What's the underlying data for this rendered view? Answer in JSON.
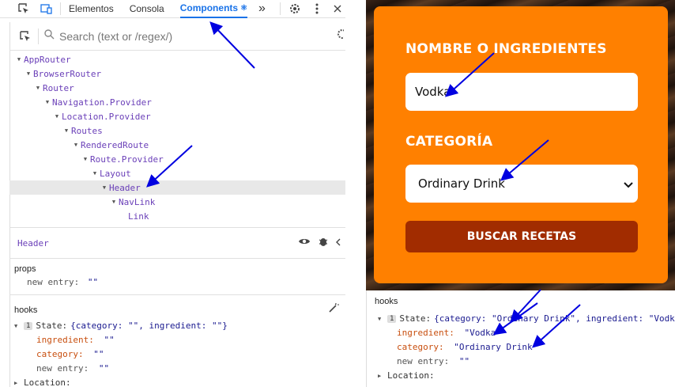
{
  "devtools": {
    "tabs": [
      {
        "label": "Elementos"
      },
      {
        "label": "Consola"
      },
      {
        "label": "Components"
      }
    ],
    "more_label": "»",
    "search_placeholder": "Search (text or /regex/)",
    "tree": [
      {
        "name": "AppRouter"
      },
      {
        "name": "BrowserRouter"
      },
      {
        "name": "Router"
      },
      {
        "name": "Navigation.Provider"
      },
      {
        "name": "Location.Provider"
      },
      {
        "name": "Routes"
      },
      {
        "name": "RenderedRoute"
      },
      {
        "name": "Route.Provider"
      },
      {
        "name": "Layout"
      },
      {
        "name": "Header"
      },
      {
        "name": "NavLink"
      },
      {
        "name": "Link"
      }
    ],
    "selected_component": "Header",
    "props_title": "props",
    "props_entry_key": "new entry:",
    "props_entry_value": "\"\"",
    "hooks_title": "hooks",
    "hook_index": "1",
    "state_label": "State:",
    "state_summary": "{category: \"\", ingredient: \"\"}",
    "ingredient_key": "ingredient:",
    "ingredient_value": "\"\"",
    "category_key": "category:",
    "category_value": "\"\"",
    "new_entry_key": "new entry:",
    "new_entry_value": "\"\"",
    "location_label": "Location:"
  },
  "form": {
    "ingredient_label": "NOMBRE O INGREDIENTES",
    "ingredient_value": "Vodka",
    "category_label": "CATEGORÍA",
    "category_value": "Ordinary Drink",
    "submit_label": "BUSCAR RECETAS",
    "card_color": "#ff8000",
    "button_color": "#a12c00"
  },
  "hooks_after": {
    "hooks_title": "hooks",
    "hook_index": "1",
    "state_label": "State:",
    "state_summary": "{category: \"Ordinary Drink\", ingredient: \"Vodka\"}",
    "ingredient_key": "ingredient:",
    "ingredient_value": "\"Vodka\"",
    "category_key": "category:",
    "category_value": "\"Ordinary Drink\"",
    "new_entry_key": "new entry:",
    "new_entry_value": "\"\"",
    "location_label": "Location:"
  },
  "annotation_color": "#0000e0"
}
